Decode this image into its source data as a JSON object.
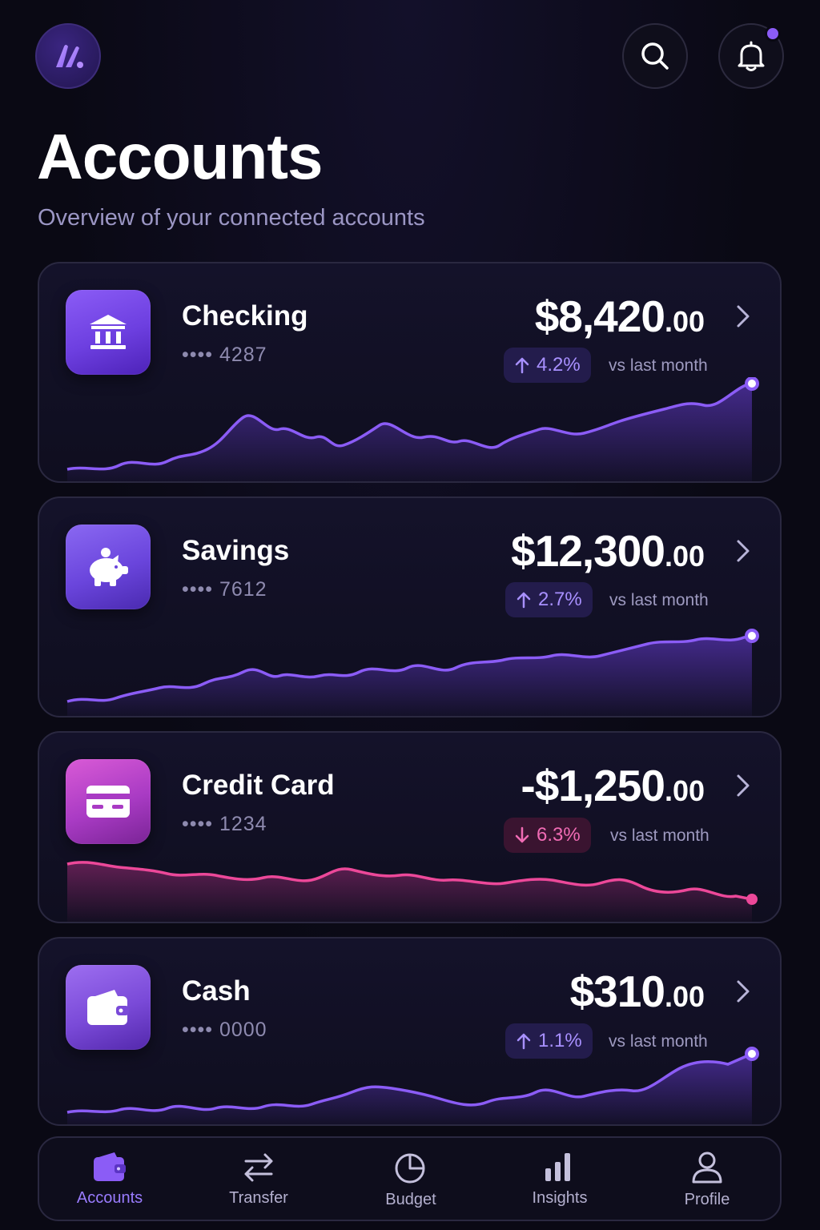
{
  "header": {
    "title": "Accounts",
    "subtitle": "Overview of your connected accounts",
    "logo_icon": "brand-logo-icon",
    "search_icon": "search-icon",
    "bell_icon": "bell-icon"
  },
  "accounts": [
    {
      "name": "Checking",
      "number": "•••• 4287",
      "amount_main": "$8,420",
      "amount_cents": ".00",
      "change": "4.2%",
      "direction": "up",
      "compare": "vs last month",
      "icon": "bank-icon",
      "color": "#8b5cf6"
    },
    {
      "name": "Savings",
      "number": "•••• 7612",
      "amount_main": "$12,300",
      "amount_cents": ".00",
      "change": "2.7%",
      "direction": "up",
      "compare": "vs last month",
      "icon": "piggy-bank-icon",
      "color": "#8b5cf6"
    },
    {
      "name": "Credit Card",
      "number": "•••• 1234",
      "amount_main": "-$1,250",
      "amount_cents": ".00",
      "change": "6.3%",
      "direction": "down",
      "compare": "vs last month",
      "icon": "credit-card-icon",
      "color": "#ec4899"
    },
    {
      "name": "Cash",
      "number": "•••• 0000",
      "amount_main": "$310",
      "amount_cents": ".00",
      "change": "1.1%",
      "direction": "up",
      "compare": "vs last month",
      "icon": "wallet-icon",
      "color": "#8b5cf6"
    }
  ],
  "tabs": [
    {
      "label": "Accounts",
      "icon": "wallet-icon",
      "active": true
    },
    {
      "label": "Transfer",
      "icon": "transfer-arrows-icon",
      "active": false
    },
    {
      "label": "Budget",
      "icon": "pie-chart-icon",
      "active": false
    },
    {
      "label": "Insights",
      "icon": "bar-chart-icon",
      "active": false
    },
    {
      "label": "Profile",
      "icon": "user-icon",
      "active": false
    }
  ],
  "colors": {
    "accent": "#8b5cf6",
    "negative": "#ec4899",
    "background": "#0a0914"
  }
}
